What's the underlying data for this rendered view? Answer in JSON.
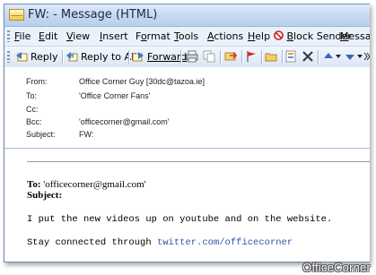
{
  "window": {
    "title": "FW:  - Message (HTML)"
  },
  "menu": [
    {
      "pre": "",
      "u": "F",
      "post": "ile"
    },
    {
      "pre": "",
      "u": "E",
      "post": "dit"
    },
    {
      "pre": "",
      "u": "V",
      "post": "iew"
    },
    {
      "pre": "",
      "u": "I",
      "post": "nsert"
    },
    {
      "pre": "F",
      "u": "o",
      "post": "rmat"
    },
    {
      "pre": "",
      "u": "T",
      "post": "ools"
    },
    {
      "pre": "",
      "u": "A",
      "post": "ctions"
    },
    {
      "pre": "",
      "u": "H",
      "post": "elp"
    },
    {
      "pre": "",
      "u": "B",
      "post": "lock Sender"
    },
    {
      "pre": "",
      "u": "M",
      "post": "essag"
    }
  ],
  "toolbar": {
    "reply": "Reply",
    "reply_all": "Reply to All",
    "forward": "Forward"
  },
  "headers": {
    "from_label": "From:",
    "from": "Office Corner Guy [30dc@tazoa.ie]",
    "to_label": "To:",
    "to": "'Office Corner Fans'",
    "cc_label": "Cc:",
    "cc": "",
    "bcc_label": "Bcc:",
    "bcc": "'officecorner@gmail.com'",
    "subject_label": "Subject:",
    "subject": "FW:"
  },
  "body": {
    "to_label": "To:",
    "to_value": " 'officecorner@gmail.com'",
    "subject_label": "Subject:",
    "line1": "I put the new videos up on youtube and on the website.",
    "line2_prefix": "Stay connected through ",
    "line2_link": "twitter.com/officecorner"
  },
  "watermark": "OfficeCorner"
}
